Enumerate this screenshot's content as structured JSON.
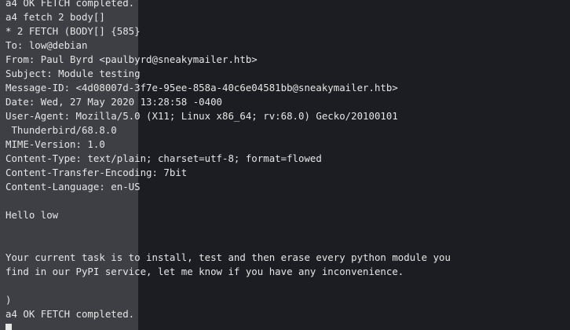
{
  "terminal": {
    "lines": [
      "a4 OK FETCH completed.",
      "a4 fetch 2 body[]",
      "* 2 FETCH (BODY[] {585}",
      "To: low@debian",
      "From: Paul Byrd <paulbyrd@sneakymailer.htb>",
      "Subject: Module testing",
      "Message-ID: <4d08007d-3f7e-95ee-858a-40c6e04581bb@sneakymailer.htb>",
      "Date: Wed, 27 May 2020 13:28:58 -0400",
      "User-Agent: Mozilla/5.0 (X11; Linux x86_64; rv:68.0) Gecko/20100101",
      " Thunderbird/68.8.0",
      "MIME-Version: 1.0",
      "Content-Type: text/plain; charset=utf-8; format=flowed",
      "Content-Transfer-Encoding: 7bit",
      "Content-Language: en-US",
      "",
      "Hello low",
      "",
      "",
      "Your current task is to install, test and then erase every python module you",
      "find in our PyPI service, let me know if you have any inconvenience.",
      "",
      ")",
      "a4 OK FETCH completed."
    ]
  },
  "colors": {
    "background": "#1c1d22",
    "selection_highlight": "#3e3f45",
    "foreground": "#e6e6e6"
  }
}
